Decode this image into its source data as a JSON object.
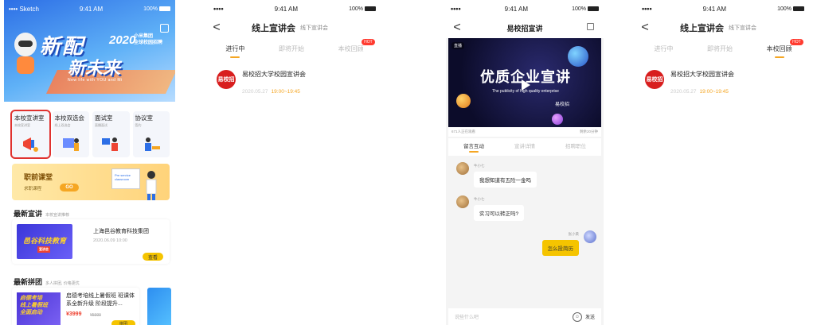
{
  "status": {
    "carrier": "Sketch",
    "time": "9:41 AM",
    "battery": "100%",
    "signal": "••••"
  },
  "home": {
    "banner": {
      "line1": "新配",
      "line2": "新未来",
      "year": "2020",
      "campaign": "小米集团\n全球校园招聘",
      "tagline": "New life with YOU and Mi"
    },
    "features": [
      {
        "title": "本校宣讲室",
        "sub": "本校宣讲室"
      },
      {
        "title": "本校双选会",
        "sub": "线上双选会"
      },
      {
        "title": "面试室",
        "sub": "直播面试"
      },
      {
        "title": "协议室",
        "sub": "签约"
      }
    ],
    "career": {
      "title": "职前课堂",
      "sub": "求职课程",
      "go": "GO",
      "screen": "Pre service\nclassroom"
    },
    "latest_lecture": {
      "heading": "最新宣讲",
      "heading_sub": "本校宣讲推荐",
      "thumb": "邑谷科技教育",
      "thumb_tag": "宣讲会",
      "title": "上海邑谷教育科技集团",
      "date": "2020.06.09 10:00",
      "button": "查看"
    },
    "group_buy": {
      "heading": "最新拼团",
      "heading_sub": "多人拼团, 价格更优",
      "thumb": "启德考培\n线上暑假班\n全面启动",
      "title": "启德考培线上暑假班 班课体系全新升级 阶段提升...",
      "price": "¥3999",
      "old_price": "¥5999",
      "button": "拼团"
    }
  },
  "lecture_page": {
    "back": "<",
    "title": "线上宣讲会",
    "subtitle": "线下宣讲会",
    "tabs": [
      "进行中",
      "即将开始",
      "本校回顾"
    ],
    "hot_badge": "HOT",
    "item": {
      "logo": "易校招",
      "title": "易校招大学校园宣讲会",
      "date": "2020.05.27",
      "time": "19:00~19:45"
    }
  },
  "live_page": {
    "title": "易校招宣讲",
    "live": "直播",
    "video_title": "优质企业宣讲",
    "video_sub": "The publicity of high quality enterprise",
    "video_brand": "易校招",
    "viewers": "671人正在观看",
    "duration": "剩余20分钟",
    "tabs": [
      "留言互动",
      "宣讲详情",
      "招聘职位"
    ],
    "messages": [
      {
        "user": "牛小七",
        "text": "我想知道有五险一金吗",
        "mine": false
      },
      {
        "user": "牛小七",
        "text": "实习可以转正吗?",
        "mine": false
      },
      {
        "user": "张小黄",
        "text": "怎么投简历",
        "mine": true
      }
    ],
    "input_placeholder": "说些什么吧",
    "send": "发送"
  }
}
